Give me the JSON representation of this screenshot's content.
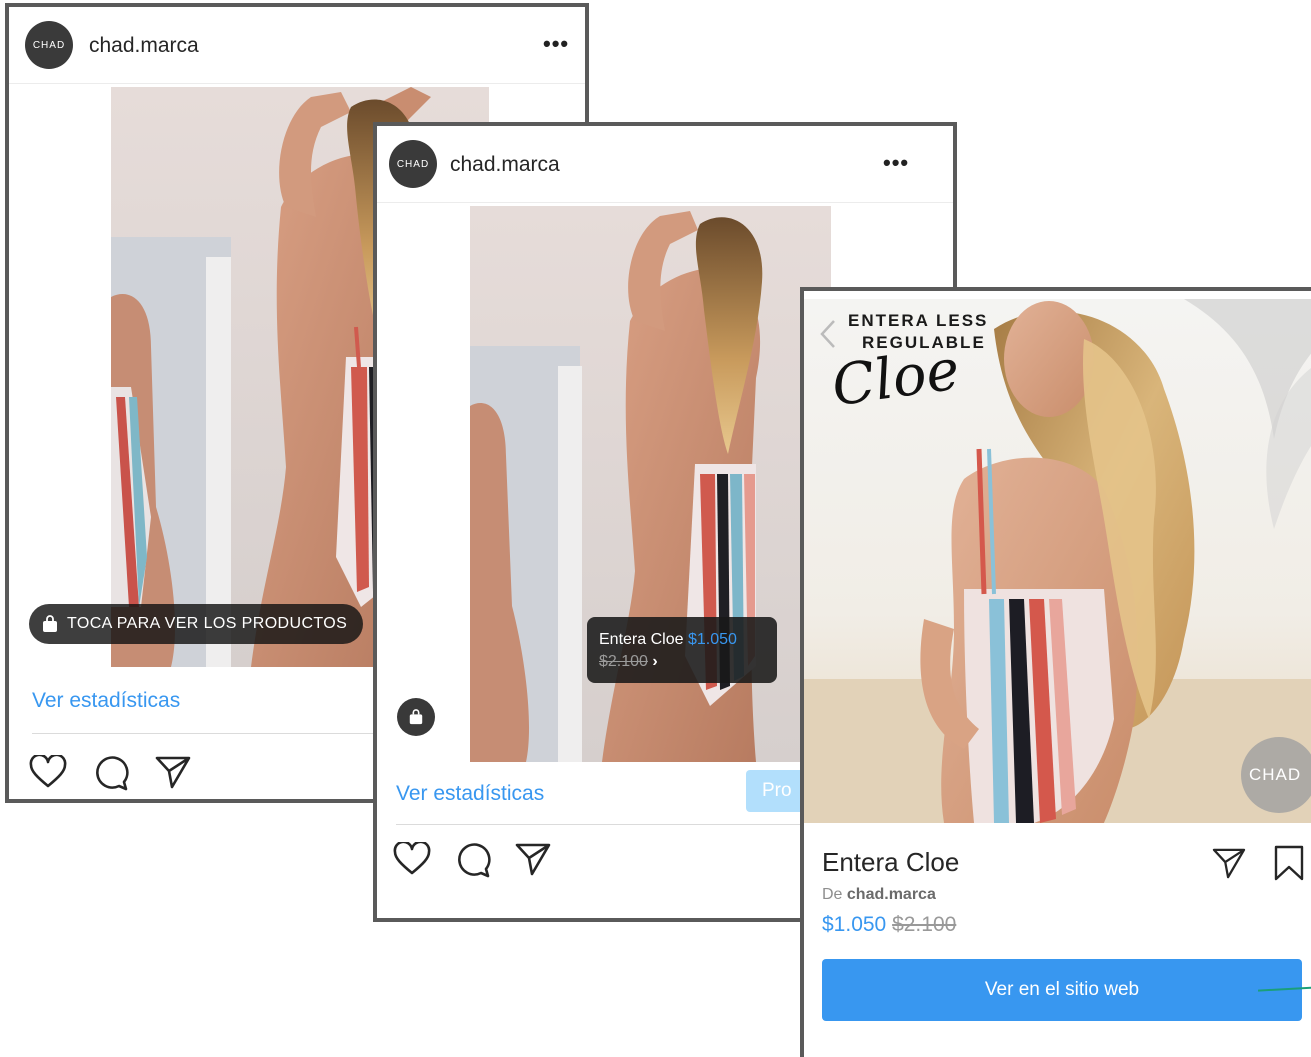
{
  "colors": {
    "accent": "#3897f0",
    "frame": "#5a5a5a",
    "text": "#262626",
    "muted": "#8e8e8e"
  },
  "post_left": {
    "avatar_text": "CHAD",
    "username": "chad.marca",
    "more_label": "•••",
    "shop_tag": "TOCA PARA VER LOS PRODUCTOS",
    "insights_link": "Ver estadísticas",
    "icons": [
      "heart-icon",
      "comment-icon",
      "share-icon",
      "shopping-bag-icon"
    ]
  },
  "post_middle": {
    "avatar_text": "CHAD",
    "username": "chad.marca",
    "more_label": "•••",
    "tag_name": "Entera Cloe",
    "tag_price": "$1.050",
    "tag_old_price": "$2.100",
    "tag_chevron": "›",
    "insights_link": "Ver estadísticas",
    "promote_button": "Pro",
    "icons": [
      "heart-icon",
      "comment-icon",
      "share-icon",
      "shopping-bag-icon"
    ]
  },
  "product_page": {
    "banner_line1": "ENTERA LESS",
    "banner_line2": "REGULABLE",
    "banner_script": "Cloe",
    "watermark": "CHAD",
    "product_name": "Entera Cloe",
    "seller_prefix": "De",
    "seller_name": "chad.marca",
    "price": "$1.050",
    "old_price": "$2.100",
    "cta_label": "Ver en el sitio web",
    "icons": [
      "back-chevron-icon",
      "share-icon",
      "bookmark-icon"
    ]
  }
}
